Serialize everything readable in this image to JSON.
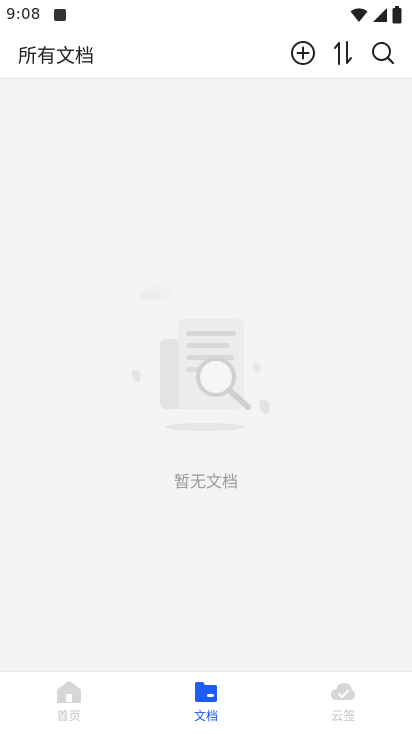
{
  "status_bar": {
    "time": "9:08"
  },
  "header": {
    "title": "所有文档",
    "actions": [
      {
        "name": "add-icon"
      },
      {
        "name": "sort-icon"
      },
      {
        "name": "search-icon"
      }
    ]
  },
  "empty_state": {
    "message": "暂无文档",
    "illustration": "document-search-illustration"
  },
  "bottom_nav": {
    "items": [
      {
        "label": "首页",
        "icon": "home-icon",
        "active": false
      },
      {
        "label": "文档",
        "icon": "folder-icon",
        "active": true
      },
      {
        "label": "云签",
        "icon": "cloud-sign-icon",
        "active": false
      }
    ]
  },
  "colors": {
    "accent": "#1f5bf5",
    "inactive": "#c4c4c4",
    "background": "#f4f4f4",
    "empty_text": "#999999"
  }
}
